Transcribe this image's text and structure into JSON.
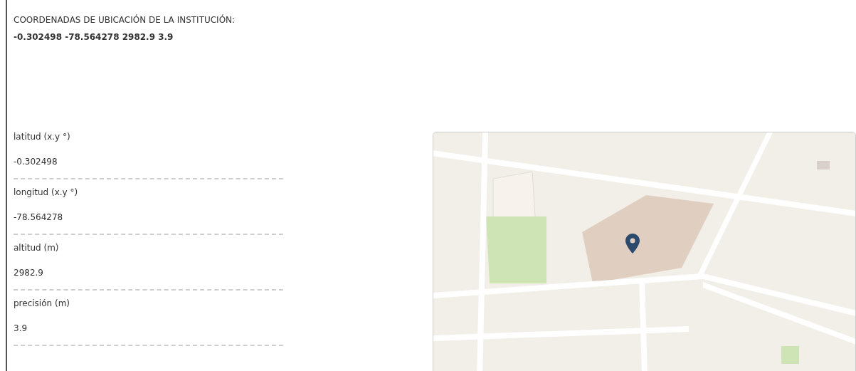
{
  "heading": "COORDENADAS DE UBICACIÓN DE LA INSTITUCIÓN:",
  "summary": "-0.302498 -78.564278 2982.9 3.9",
  "fields": [
    {
      "label": "latitud (x.y °)",
      "value": "-0.302498"
    },
    {
      "label": "longitud (x.y °)",
      "value": "-78.564278"
    },
    {
      "label": "altitud (m)",
      "value": "2982.9"
    },
    {
      "label": "precisión (m)",
      "value": "3.9"
    }
  ]
}
